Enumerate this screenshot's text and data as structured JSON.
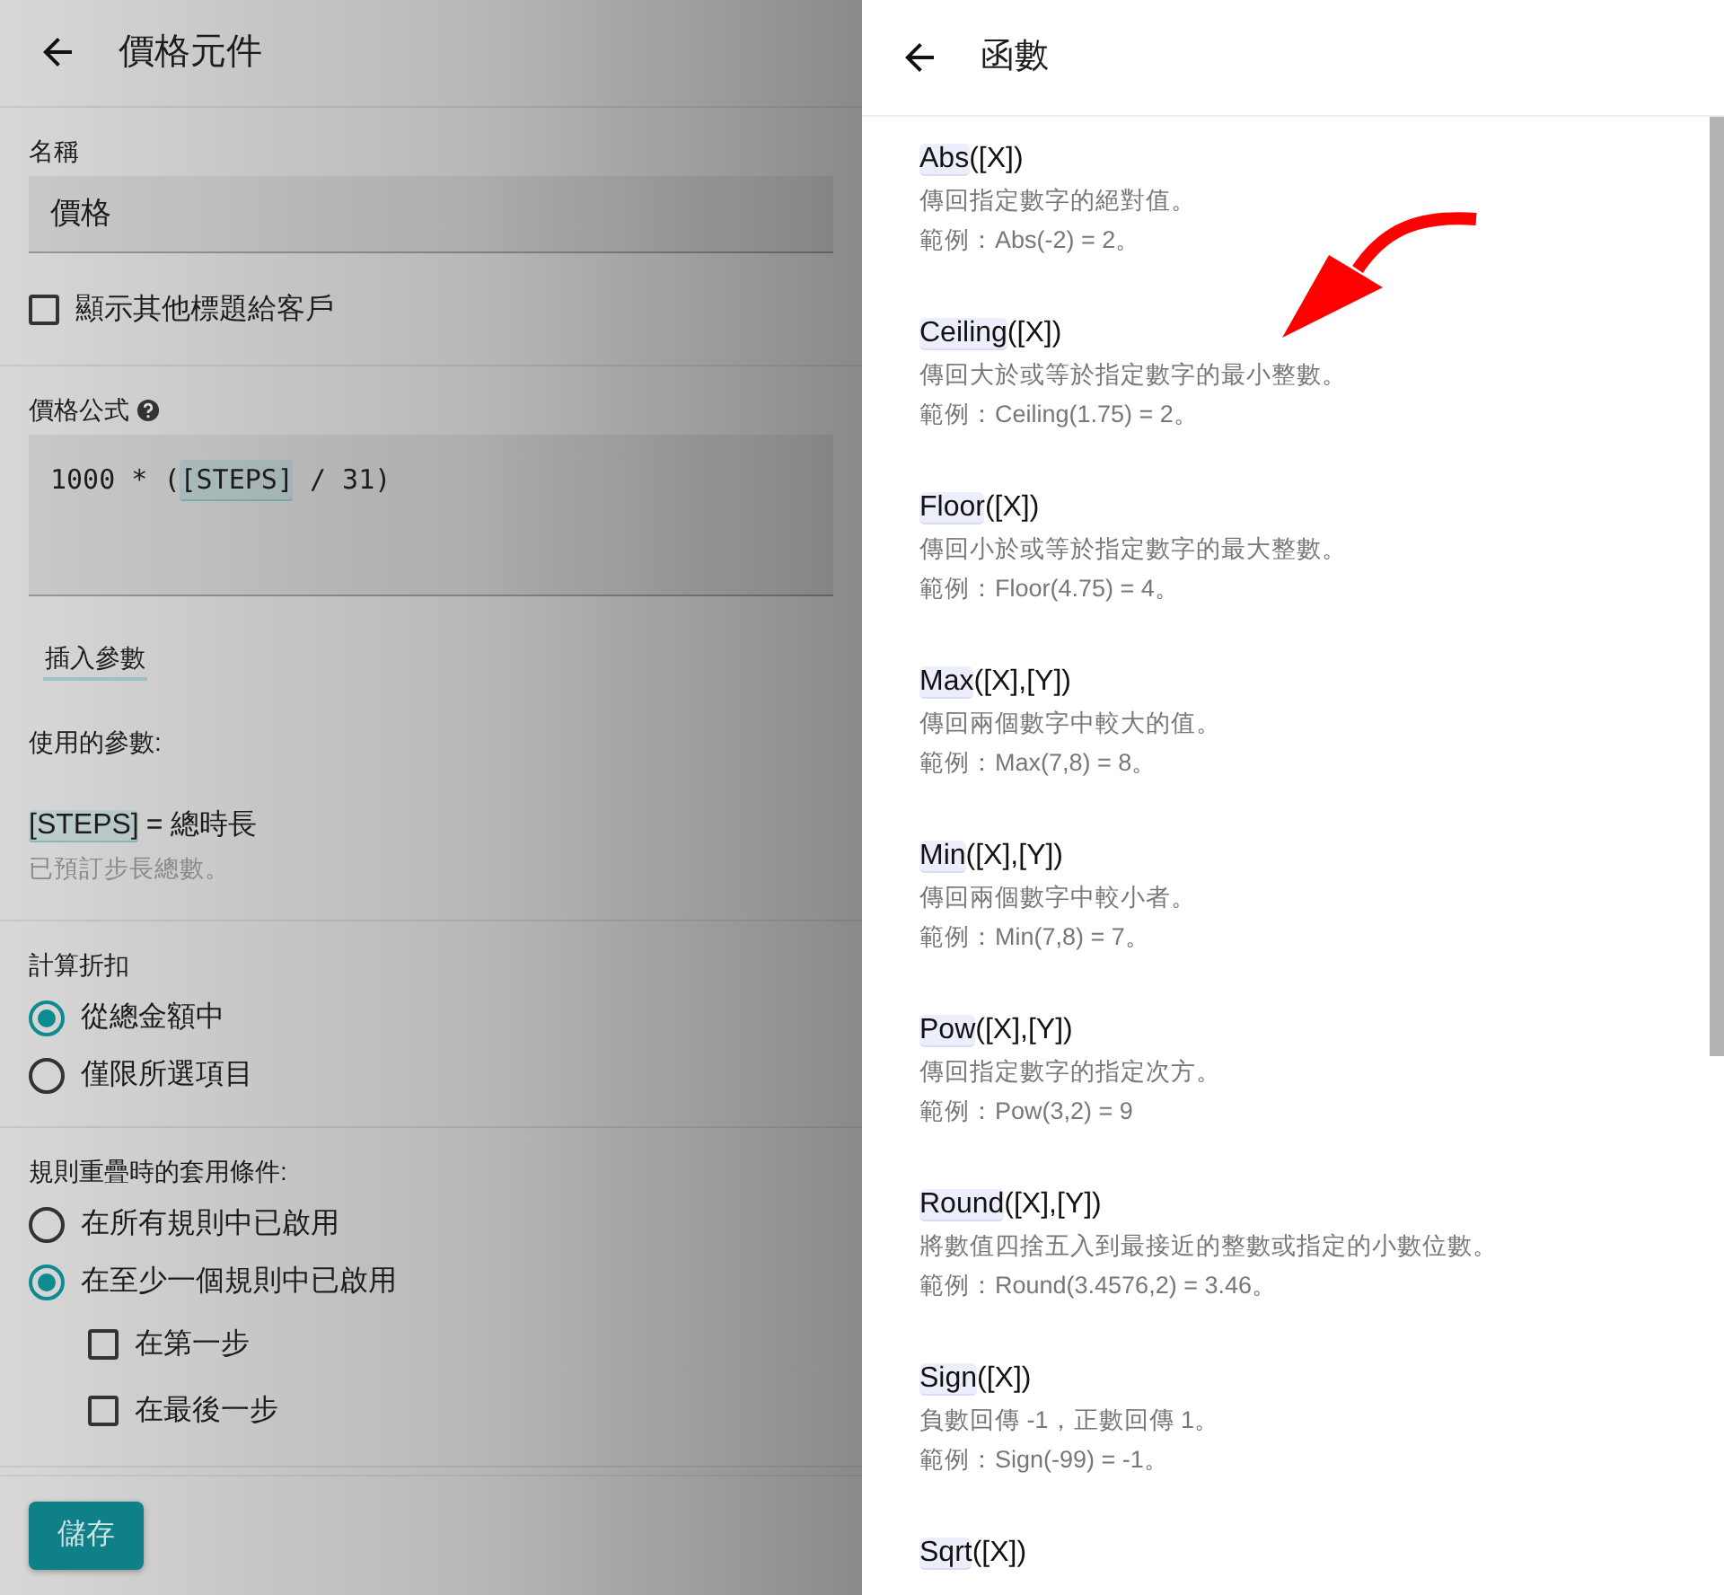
{
  "editor": {
    "title": "價格元件",
    "name_field": {
      "label": "名稱",
      "value": "價格"
    },
    "show_titles": {
      "label": "顯示其他標題給客戶",
      "checked": false
    },
    "formula": {
      "label": "價格公式",
      "parts": [
        {
          "kind": "plain",
          "text": "1000 * ("
        },
        {
          "kind": "param",
          "text": "[STEPS]"
        },
        {
          "kind": "plain",
          "text": " / 31)"
        }
      ]
    },
    "insert_link": "插入參數",
    "used_params": {
      "label": "使用的參數:",
      "items": [
        {
          "param": "[STEPS]",
          "meaning": "= 總時長",
          "description": "已預訂步長總數。"
        }
      ]
    },
    "discount": {
      "label": "計算折扣",
      "options": [
        {
          "label": "從總金額中",
          "selected": true
        },
        {
          "label": "僅限所選項目",
          "selected": false
        }
      ]
    },
    "overlap": {
      "label": "規則重疊時的套用條件:",
      "options": [
        {
          "label": "在所有規則中已啟用",
          "selected": false
        },
        {
          "label": "在至少一個規則中已啟用",
          "selected": true
        }
      ],
      "sub_options": [
        {
          "label": "在第一步",
          "checked": false
        },
        {
          "label": "在最後一步",
          "checked": false
        }
      ]
    },
    "save_button": "儲存"
  },
  "drawer": {
    "title": "函數",
    "functions": [
      {
        "name": "Abs",
        "args": "([X])",
        "description": "傳回指定數字的絕對值。",
        "example": "範例：Abs(-2) = 2。"
      },
      {
        "name": "Ceiling",
        "args": "([X])",
        "description": "傳回大於或等於指定數字的最小整數。",
        "example": "範例：Ceiling(1.75) = 2。"
      },
      {
        "name": "Floor",
        "args": "([X])",
        "description": "傳回小於或等於指定數字的最大整數。",
        "example": "範例：Floor(4.75) = 4。"
      },
      {
        "name": "Max",
        "args": "([X],[Y])",
        "description": "傳回兩個數字中較大的值。",
        "example": "範例：Max(7,8) = 8。"
      },
      {
        "name": "Min",
        "args": "([X],[Y])",
        "description": "傳回兩個數字中較小者。",
        "example": "範例：Min(7,8) = 7。"
      },
      {
        "name": "Pow",
        "args": "([X],[Y])",
        "description": "傳回指定數字的指定次方。",
        "example": "範例：Pow(3,2) = 9"
      },
      {
        "name": "Round",
        "args": "([X],[Y])",
        "description": "將數值四捨五入到最接近的整數或指定的小數位數。",
        "example": "範例：Round(3.4576,2) = 3.46。"
      },
      {
        "name": "Sign",
        "args": "([X])",
        "description": "負數回傳 -1，正數回傳 1。",
        "example": "範例：Sign(-99) = -1。"
      },
      {
        "name": "Sqrt",
        "args": "([X])"
      }
    ]
  }
}
